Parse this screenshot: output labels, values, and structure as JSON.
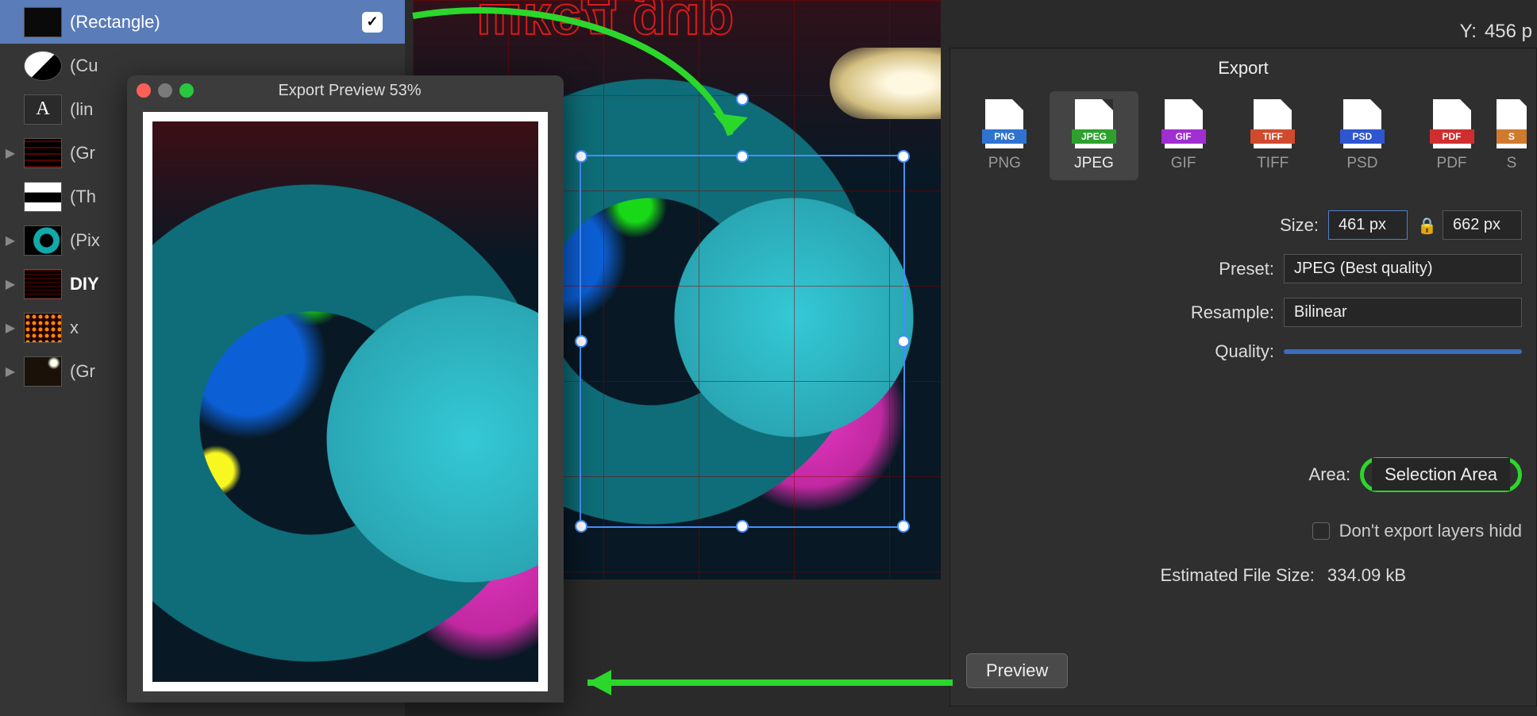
{
  "coord": {
    "label": "Y:",
    "value": "456 p"
  },
  "layers": [
    {
      "label": "(Rectangle)",
      "selected": true,
      "thumb": "rect",
      "checked": true
    },
    {
      "label": "(Cu",
      "thumb": "circle-bw"
    },
    {
      "label": "(lin",
      "thumb": "A"
    },
    {
      "label": "(Gr",
      "thumb": "red-grid",
      "disclose": true
    },
    {
      "label": "(Th",
      "thumb": "bw-bars"
    },
    {
      "label": "(Pix",
      "thumb": "teal-ring",
      "disclose": true
    },
    {
      "label": "DIY",
      "thumb": "red-grid2",
      "disclose": true
    },
    {
      "label": "x",
      "thumb": "dots",
      "disclose": true
    },
    {
      "label": "(Gr",
      "thumb": "photo",
      "disclose": true
    }
  ],
  "previewWindow": {
    "title": "Export Preview 53%"
  },
  "export": {
    "title": "Export",
    "formats": [
      {
        "code": "PNG",
        "label": "PNG",
        "color": "#2e73d0"
      },
      {
        "code": "JPEG",
        "label": "JPEG",
        "color": "#2ea02e",
        "selected": true
      },
      {
        "code": "GIF",
        "label": "GIF",
        "color": "#a02ed0"
      },
      {
        "code": "TIFF",
        "label": "TIFF",
        "color": "#d04a2e"
      },
      {
        "code": "PSD",
        "label": "PSD",
        "color": "#2e56d0"
      },
      {
        "code": "PDF",
        "label": "PDF",
        "color": "#d02e2e"
      },
      {
        "code": "S",
        "label": "S",
        "color": "#d07a2e"
      }
    ],
    "size": {
      "label": "Size:",
      "w": "461 px",
      "h": "662 px"
    },
    "preset": {
      "label": "Preset:",
      "value": "JPEG (Best quality)"
    },
    "resample": {
      "label": "Resample:",
      "value": "Bilinear"
    },
    "quality": {
      "label": "Quality:"
    },
    "area": {
      "label": "Area:",
      "value": "Selection Area"
    },
    "dontExport": {
      "label": "Don't export layers hidd"
    },
    "estimate": {
      "label": "Estimated File Size:",
      "value": "334.09 kB"
    },
    "previewBtn": "Preview"
  }
}
